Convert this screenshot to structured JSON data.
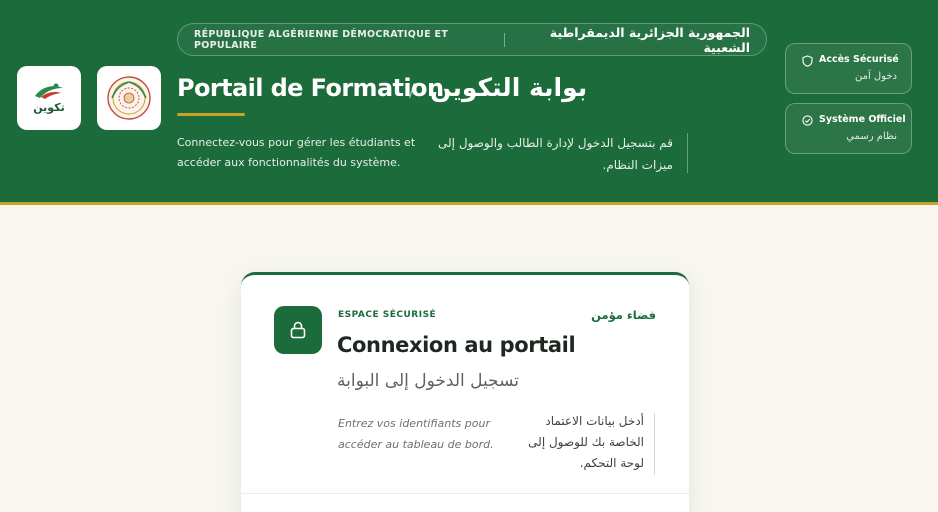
{
  "header": {
    "republic_fr": "RÉPUBLIQUE ALGÉRIENNE DÉMOCRATIQUE ET POPULAIRE",
    "republic_ar": "الجمهورية الجزائرية الديمقراطية الشعبية",
    "title_fr": "Portail de Formation",
    "title_separator": "/",
    "title_ar": "بوابة التكوين",
    "description_fr": "Connectez-vous pour gérer les étudiants et accéder aux fonctionnalités du système.",
    "description_ar": "قم بتسجيل الدخول لإدارة الطالب والوصول إلى ميزات النظام.",
    "logo_text": "تكوين",
    "accent_color": "#c9a22a",
    "brand_color": "#1c6b3a"
  },
  "badges": [
    {
      "title": "Accès Sécurisé",
      "subtitle": "دخول آمن",
      "icon": "shield-icon"
    },
    {
      "title": "Système Officiel",
      "subtitle": "نظام رسمي",
      "icon": "check-circle-icon"
    }
  ],
  "card": {
    "label_fr": "ESPACE SÉCURISÉ",
    "label_ar": "فضاء مؤمن",
    "title": "Connexion au portail",
    "subtitle_ar": "تسجيل الدخول إلى البوابة",
    "hint_fr": "Entrez vos identifiants pour accéder au tableau de bord.",
    "hint_ar": "أدخل بيانات الاعتماد الخاصة بك للوصول إلى لوحة التحكم.",
    "icon": "lock-icon"
  }
}
